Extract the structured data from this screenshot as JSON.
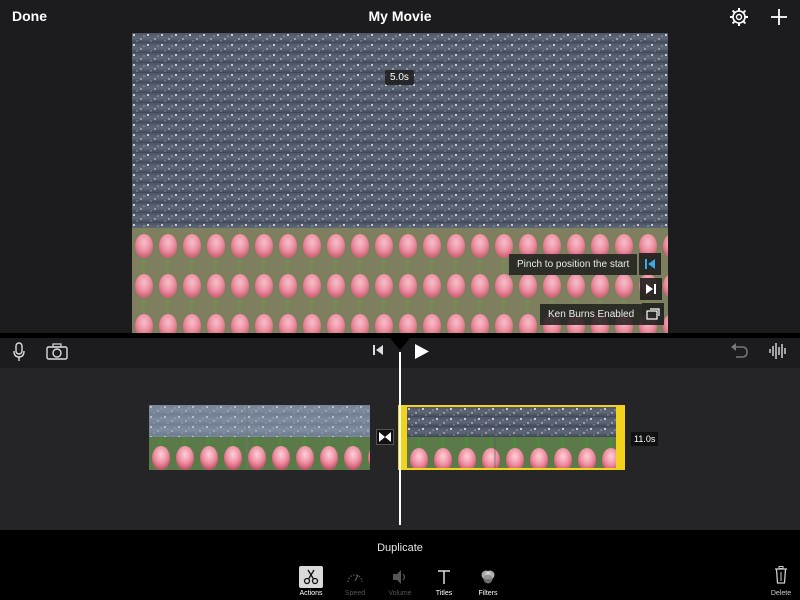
{
  "header": {
    "done_label": "Done",
    "title": "My Movie"
  },
  "preview": {
    "time_badge": "5.0s",
    "pinch_hint": "Pinch to position the start",
    "ken_burns": "Ken Burns Enabled"
  },
  "timeline": {
    "clip_duration": "11.0s"
  },
  "bottom": {
    "action_title": "Duplicate",
    "tools": [
      {
        "label": "Actions"
      },
      {
        "label": "Speed"
      },
      {
        "label": "Volume"
      },
      {
        "label": "Titles"
      },
      {
        "label": "Filters"
      }
    ],
    "delete_label": "Delete"
  },
  "colors": {
    "accent_yellow": "#f2d21a",
    "accent_blue": "#3aa7e6"
  }
}
